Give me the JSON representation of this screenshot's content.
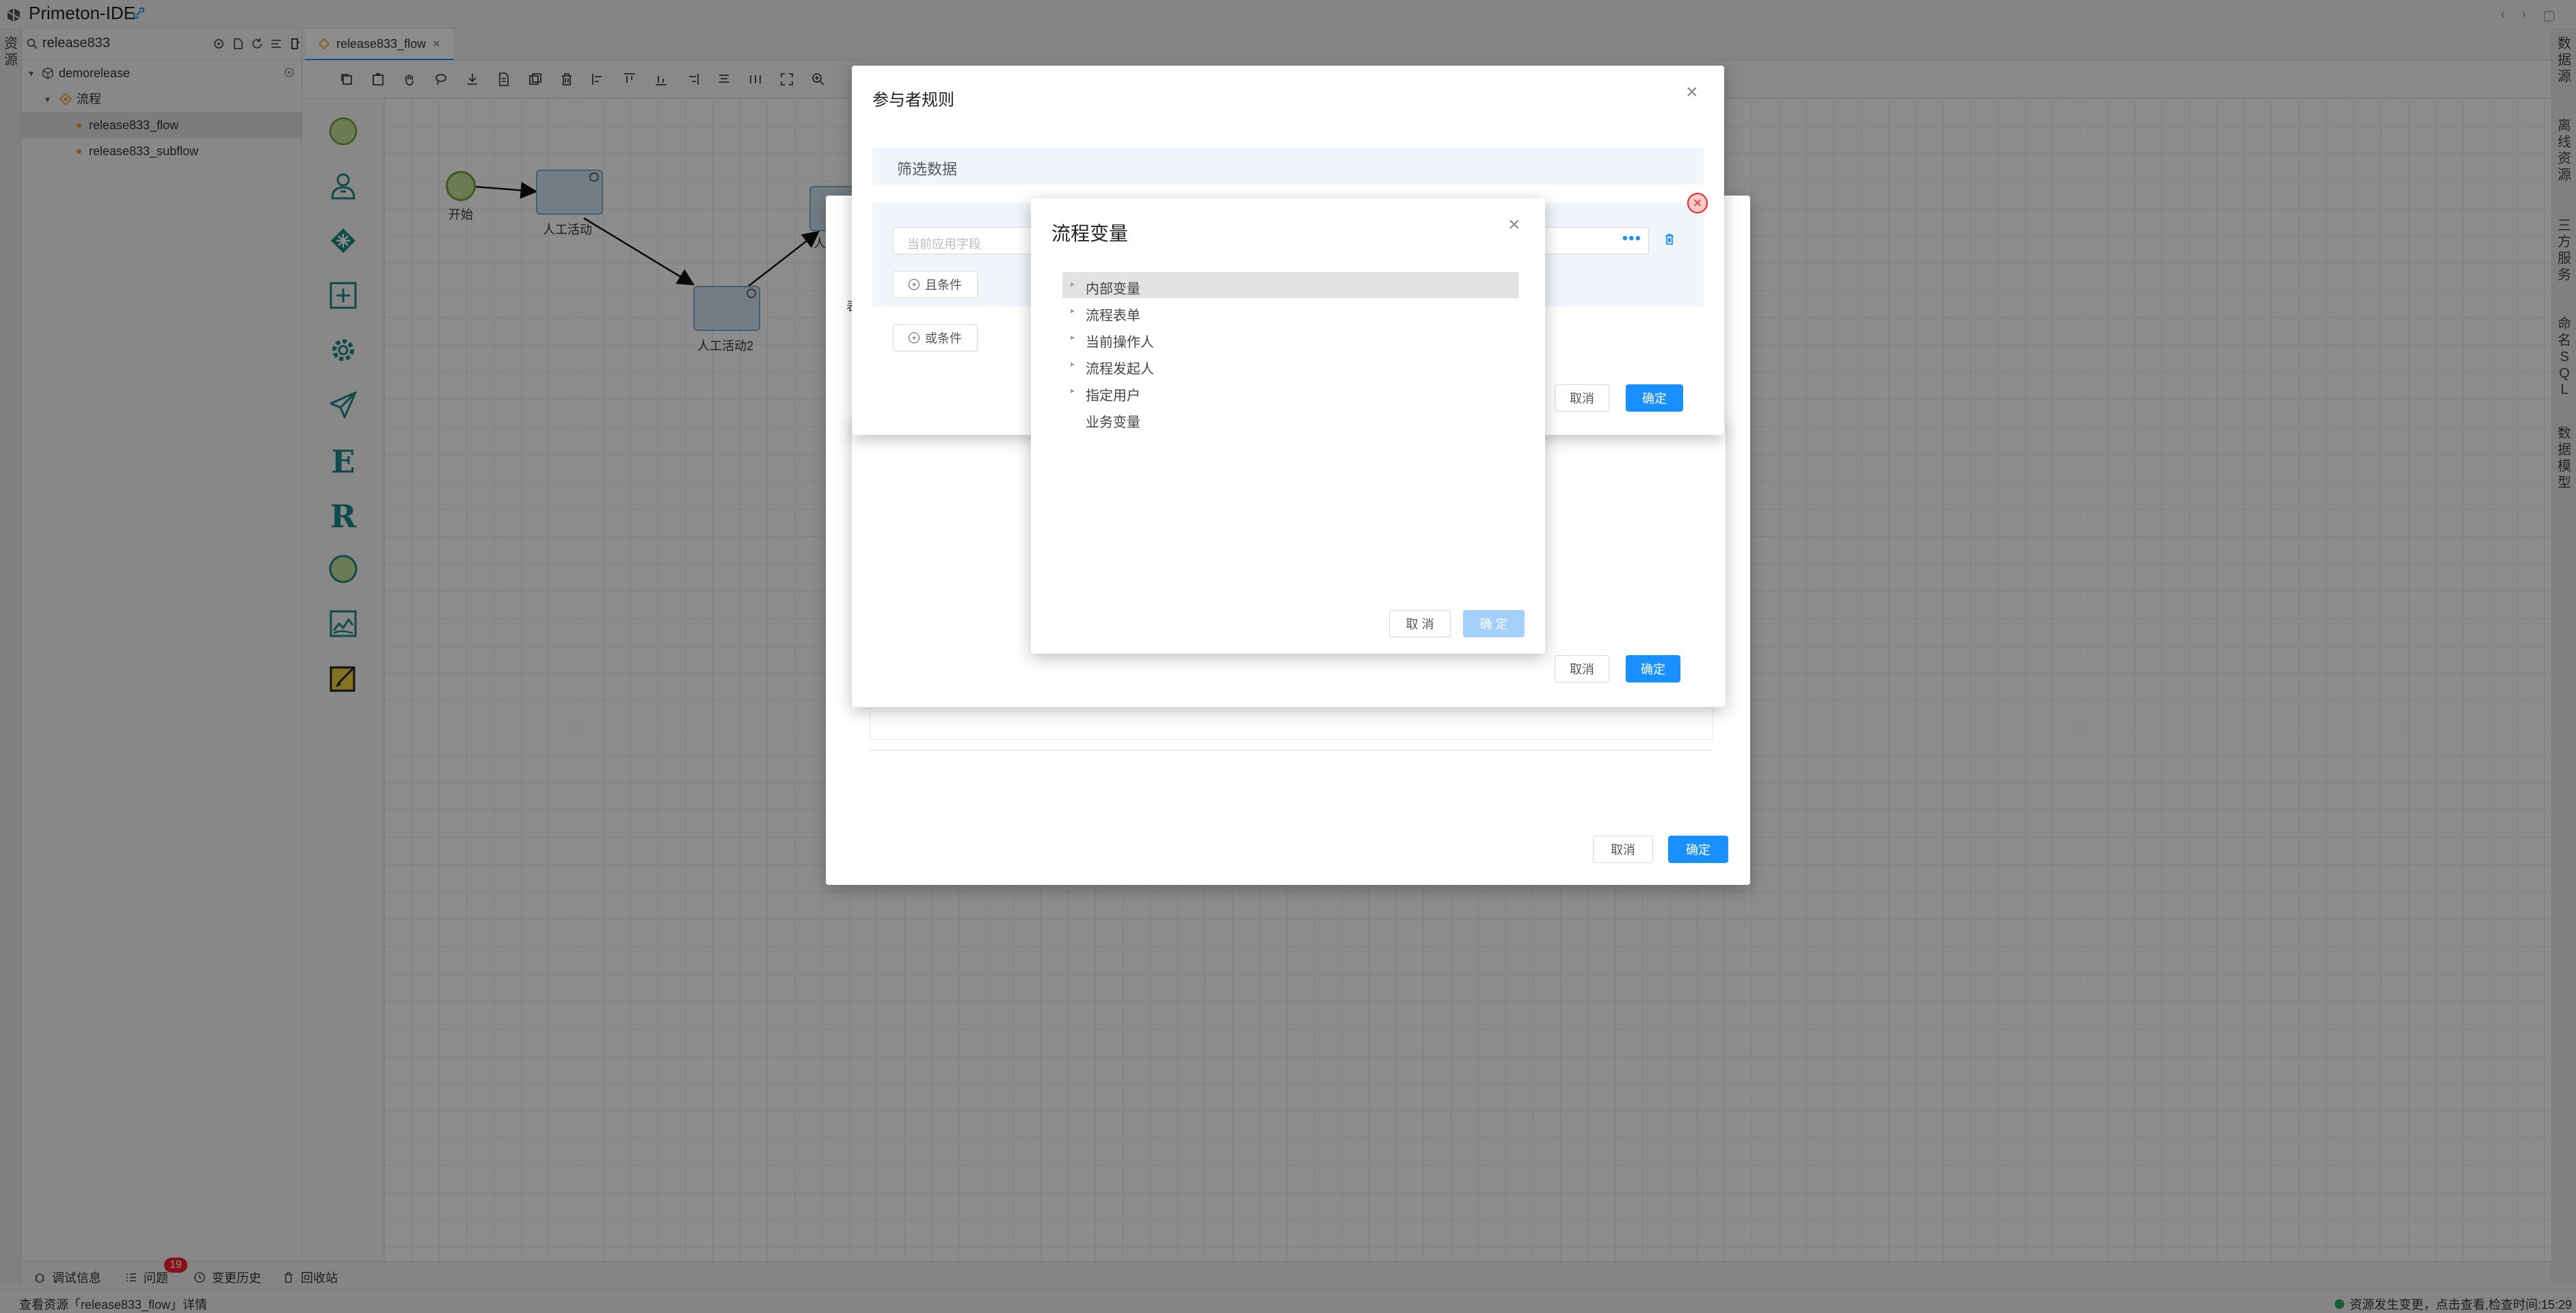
{
  "app": {
    "title": "Primeton-IDE"
  },
  "left_strip": {
    "label": "资源"
  },
  "explorer": {
    "search_value": "release833",
    "tree": {
      "project": "demorelease",
      "folder": "流程",
      "items": [
        "release833_flow",
        "release833_subflow"
      ]
    }
  },
  "editor": {
    "tab_label": "release833_flow",
    "nodes": {
      "start": "开始",
      "task1": "人工活动",
      "task2": "人工活动2",
      "task3_partial": "人"
    }
  },
  "right_strip": {
    "items": [
      "数据源",
      "离线资源",
      "三方服务",
      "命名SQL",
      "数据模型"
    ]
  },
  "bottom_tabs": {
    "debug": "调试信息",
    "problems": "问题",
    "problems_count": "19",
    "history": "变更历史",
    "recycle": "回收站"
  },
  "statusbar": {
    "left": "查看资源「release833_flow」详情",
    "right": "资源发生变更，点击查看,检查时间:15:29"
  },
  "bg_dialog": {
    "cancel": "取消",
    "confirm": "确定",
    "partial_char": "表"
  },
  "mid_dialog": {
    "cancel": "取消",
    "confirm": "确定"
  },
  "rules_dialog": {
    "title": "参与者规则",
    "section_title": "筛选数据",
    "field_placeholder": "当前应用字段",
    "and_condition": "且条件",
    "or_condition": "或条件",
    "cancel": "取消",
    "confirm": "确定"
  },
  "var_dialog": {
    "title": "流程变量",
    "tree": [
      {
        "label": "内部变量",
        "expandable": true,
        "selected": true
      },
      {
        "label": "流程表单",
        "expandable": true,
        "selected": false
      },
      {
        "label": "当前操作人",
        "expandable": true,
        "selected": false
      },
      {
        "label": "流程发起人",
        "expandable": true,
        "selected": false
      },
      {
        "label": "指定用户",
        "expandable": true,
        "selected": false
      },
      {
        "label": "业务变量",
        "expandable": false,
        "selected": false
      }
    ],
    "cancel": "取 消",
    "confirm": "确 定"
  },
  "colors": {
    "primary": "#1890ff",
    "primary_disabled": "#a3d0fd",
    "palette_teal": "#1a8a8a",
    "start_event": "#c3e29a",
    "danger": "#f5222d"
  }
}
